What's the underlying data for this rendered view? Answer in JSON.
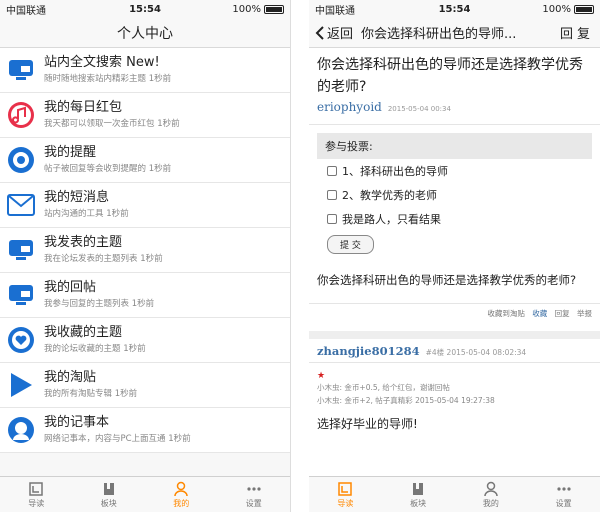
{
  "left": {
    "status": {
      "carrier": "中国联通",
      "time": "15:54",
      "battery": "100%"
    },
    "nav_title": "个人中心",
    "items": [
      {
        "title": "站内全文搜索 New!",
        "sub": "随时随地搜索站内精彩主题 1秒前",
        "icon": "search-monitor-icon"
      },
      {
        "title": "我的每日红包",
        "sub": "我天都可以领取一次金币红包 1秒前",
        "icon": "music-note-icon"
      },
      {
        "title": "我的提醒",
        "sub": "帖子被回复等会收到提醒的 1秒前",
        "icon": "headphones-icon"
      },
      {
        "title": "我的短消息",
        "sub": "站内沟通的工具 1秒前",
        "icon": "mail-icon"
      },
      {
        "title": "我发表的主题",
        "sub": "我在论坛发表的主题列表 1秒前",
        "icon": "monitor-icon"
      },
      {
        "title": "我的回帖",
        "sub": "我参与回复的主题列表 1秒前",
        "icon": "reply-monitor-icon"
      },
      {
        "title": "我收藏的主题",
        "sub": "我的论坛收藏的主题 1秒前",
        "icon": "heart-icon"
      },
      {
        "title": "我的淘贴",
        "sub": "我的所有淘贴专辑 1秒前",
        "icon": "play-icon"
      },
      {
        "title": "我的记事本",
        "sub": "网络记事本，内容与PC上面互通 1秒前",
        "icon": "person-icon"
      }
    ],
    "tabs": [
      {
        "label": "导读",
        "active": false
      },
      {
        "label": "板块",
        "active": false
      },
      {
        "label": "我的",
        "active": true
      },
      {
        "label": "设置",
        "active": false
      }
    ]
  },
  "right": {
    "status": {
      "carrier": "中国联通",
      "time": "15:54",
      "battery": "100%"
    },
    "back_label": "返回",
    "nav_title": "你会选择科研出色的导师...",
    "reply_label": "回复",
    "post_title": "你会选择科研出色的导师还是选择教学优秀的老师?",
    "author": "eriophyoid",
    "date": "2015-05-04 00:34",
    "poll_header": "参与投票:",
    "poll_options": [
      "1、择科研出色的导师",
      "2、教学优秀的老师",
      "我是路人，只看结果"
    ],
    "submit_label": "提 交",
    "body": "你会选择科研出色的导师还是选择教学优秀的老师?",
    "actions": [
      "收藏到淘贴",
      "收藏",
      "回复",
      "举报"
    ],
    "reply": {
      "author": "zhangjie801284",
      "floor": "#4楼 2015-05-04 08:02:34",
      "rate1": "小木虫: 金币+0.5, 给个红包，谢谢回帖",
      "rate2": "小木虫: 金币+2, 帖子真精彩 2015-05-04 19:27:38",
      "body_partial": "选择好毕业的导师!"
    },
    "tabs": [
      {
        "label": "导读",
        "active": true
      },
      {
        "label": "板块",
        "active": false
      },
      {
        "label": "我的",
        "active": false
      },
      {
        "label": "设置",
        "active": false
      }
    ]
  },
  "colors": {
    "accent": "#ff8800",
    "link": "#3a6ea5",
    "icon_blue": "#1a6fd1"
  }
}
